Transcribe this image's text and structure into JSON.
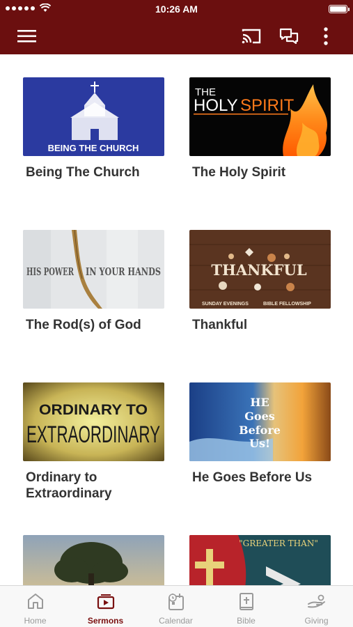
{
  "status_bar": {
    "time": "10:26 AM"
  },
  "app_bar": {
    "icons": [
      "menu-icon",
      "cast-icon",
      "chat-icon",
      "more-vertical-icon"
    ]
  },
  "colors": {
    "primary": "#6b0f0f",
    "active_tab": "#7a1010",
    "inactive_tab": "#9a9a9a"
  },
  "sermons": [
    {
      "title": "Being The Church",
      "art_text": "BEING THE CHURCH"
    },
    {
      "title": "The Holy Spirit",
      "art_text_1": "THE",
      "art_text_2": "HOLY",
      "art_text_3": "SPIRIT"
    },
    {
      "title": "The Rod(s) of God",
      "art_text_1": "HIS POWER",
      "art_text_2": "IN YOUR HANDS"
    },
    {
      "title": "Thankful",
      "art_text": "THANKFUL",
      "art_sub_1": "SUNDAY EVENINGS",
      "art_sub_2": "BIBLE FELLOWSHIP"
    },
    {
      "title": "Ordinary to Extraordinary",
      "art_text_1": "ORDINARY TO",
      "art_text_2": "EXTRAORDINARY"
    },
    {
      "title": "He Goes Before Us",
      "art_text_1": "HE",
      "art_text_2": "Goes",
      "art_text_3": "Before",
      "art_text_4": "Us!"
    },
    {
      "title": "",
      "art_text": ""
    },
    {
      "title": "",
      "art_text": "\"GREATER THAN\""
    }
  ],
  "tabs": [
    {
      "label": "Home",
      "icon": "home-icon",
      "active": false
    },
    {
      "label": "Sermons",
      "icon": "sermons-icon",
      "active": true
    },
    {
      "label": "Calendar",
      "icon": "calendar-icon",
      "active": false
    },
    {
      "label": "Bible",
      "icon": "bible-icon",
      "active": false
    },
    {
      "label": "Giving",
      "icon": "giving-icon",
      "active": false
    }
  ]
}
